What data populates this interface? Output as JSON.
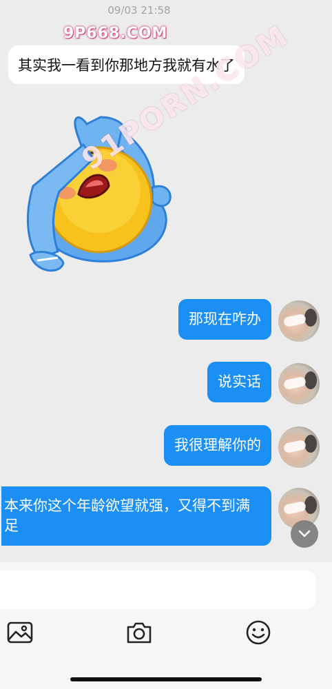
{
  "header": {
    "timestamp": "09/03 21:58"
  },
  "watermark": {
    "top_text": "9P668.COM",
    "diagonal_text": "91PORN.COM"
  },
  "messages": [
    {
      "direction": "in",
      "type": "text",
      "text": "其实我一看到你那地方我就有水了"
    },
    {
      "direction": "in",
      "type": "sticker",
      "sticker": "crying-face-sticker"
    },
    {
      "direction": "out",
      "type": "text",
      "text": "那现在咋办"
    },
    {
      "direction": "out",
      "type": "text",
      "text": "说实话"
    },
    {
      "direction": "out",
      "type": "text",
      "text": "我很理解你的"
    },
    {
      "direction": "out",
      "type": "text",
      "text": "本来你这个年龄欲望就强，又得不到满足"
    }
  ],
  "composer": {
    "value": "",
    "placeholder": ""
  },
  "toolbar": {
    "icons": [
      "image-icon",
      "camera-icon",
      "emoji-icon"
    ]
  },
  "colors": {
    "background": "#ececec",
    "outgoing_bubble": "#1b8ff5",
    "incoming_bubble": "#ffffff",
    "timestamp": "#a2a2a2"
  }
}
